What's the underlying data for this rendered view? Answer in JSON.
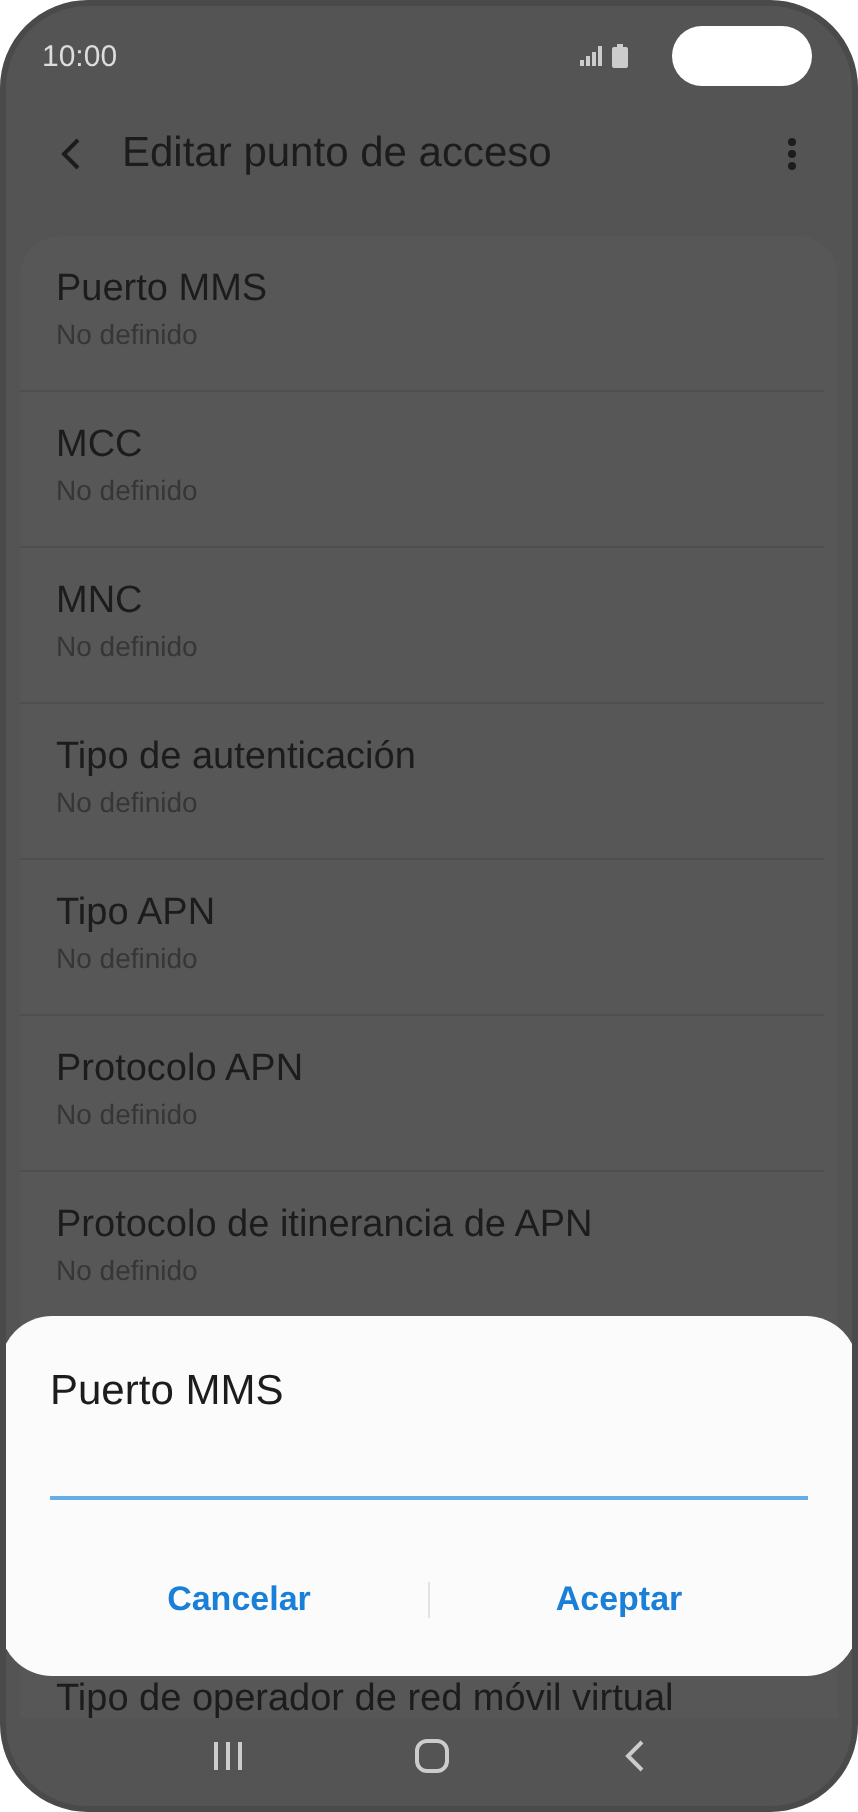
{
  "status_bar": {
    "time": "10:00"
  },
  "header": {
    "title": "Editar punto de acceso"
  },
  "settings": [
    {
      "title": "Puerto MMS",
      "value": "No definido"
    },
    {
      "title": "MCC",
      "value": "No definido"
    },
    {
      "title": "MNC",
      "value": "No definido"
    },
    {
      "title": "Tipo de autenticación",
      "value": "No definido"
    },
    {
      "title": "Tipo APN",
      "value": "No definido"
    },
    {
      "title": "Protocolo APN",
      "value": "No definido"
    },
    {
      "title": "Protocolo de itinerancia de APN",
      "value": "No definido"
    }
  ],
  "partly_hidden_setting": {
    "title": "Tipo de operador de red móvil virtual"
  },
  "dialog": {
    "title": "Puerto MMS",
    "buttons": [
      "Cancelar",
      "Aceptar"
    ]
  }
}
